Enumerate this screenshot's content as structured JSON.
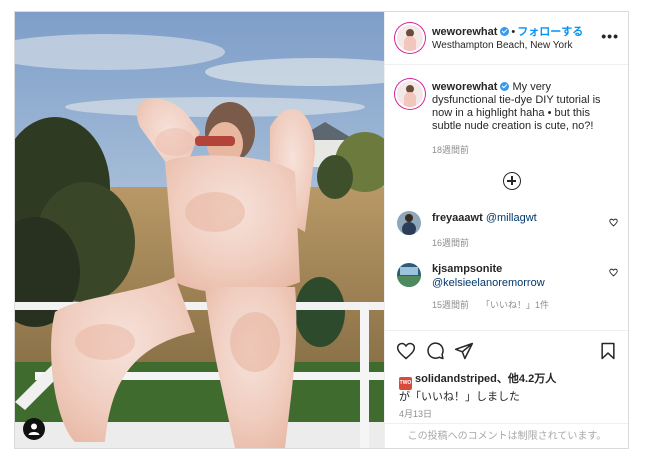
{
  "post": {
    "username": "weworewhat",
    "follow_label": "フォローする",
    "location": "Westhampton Beach, New York",
    "more_label": "•••"
  },
  "caption": {
    "username": "weworewhat",
    "text": "My very dysfunctional tie-dye DIY tutorial is now in a highlight haha • but this subtle nude creation is cute, no?!",
    "time": "18週間前"
  },
  "comments": [
    {
      "username": "freyaaawt",
      "text": "@millagwt",
      "time": "16週間前",
      "likes": ""
    },
    {
      "username": "kjsampsonite",
      "text": "@kelsieelanoremorrow",
      "time": "15週間前",
      "likes": "「いいね！」1件"
    }
  ],
  "likes": {
    "avatar_text": "TWO",
    "user": "solidandstriped",
    "others": "、他4.2万人",
    "suffix": "が「いいね！」しました"
  },
  "date": "4月13日",
  "comments_disabled": "この投稿へのコメントは制限されています。",
  "colors": {
    "accent": "#0095f6",
    "story_ring": "#d6249f"
  },
  "icons": [
    "heart-icon",
    "comment-icon",
    "share-icon",
    "bookmark-icon",
    "plus-circle-icon",
    "user-tag-icon",
    "verified-badge-icon"
  ]
}
